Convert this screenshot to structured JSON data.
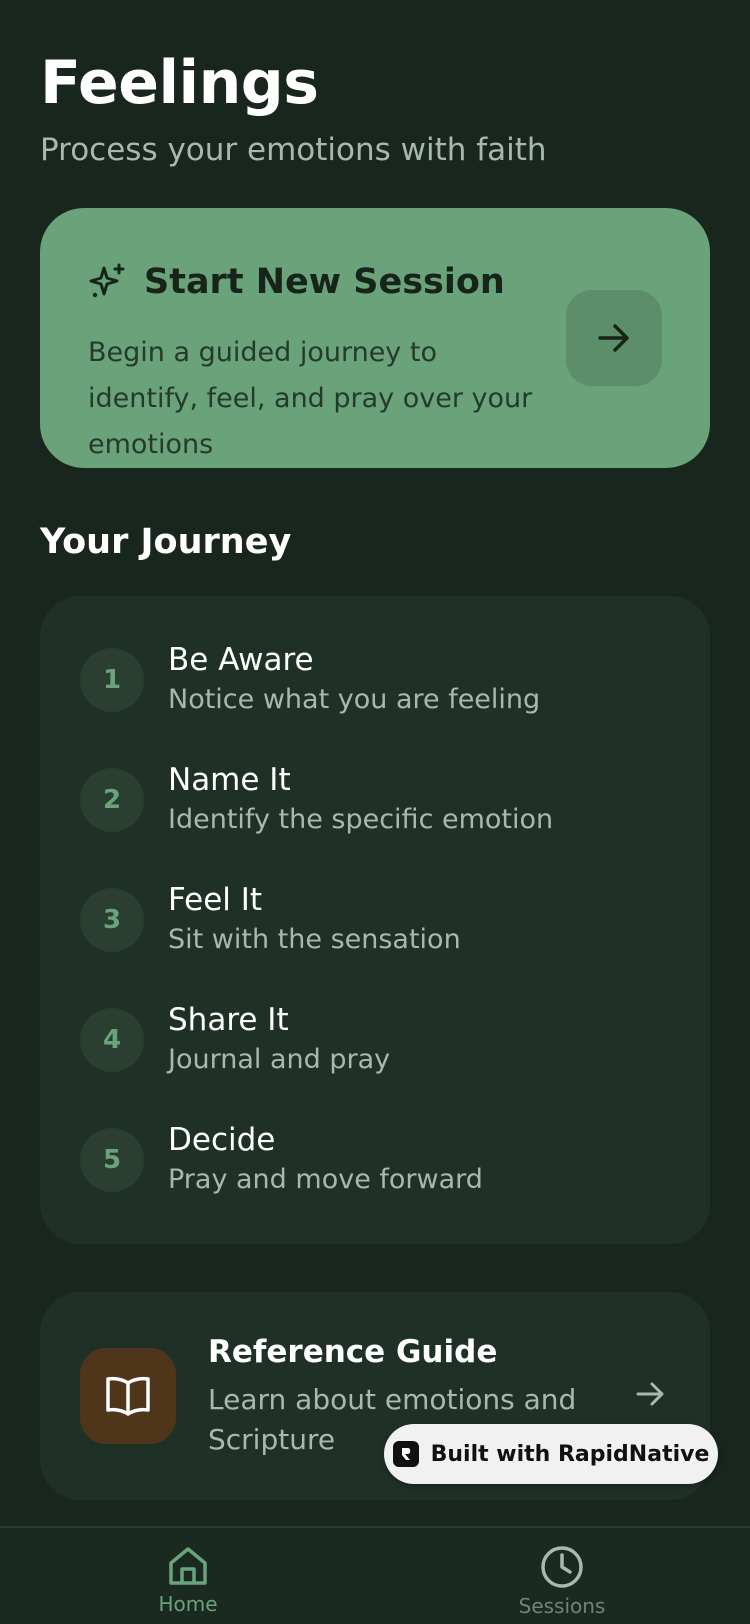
{
  "header": {
    "title": "Feelings",
    "subtitle": "Process your emotions with faith"
  },
  "session_card": {
    "title": "Start New Session",
    "description": "Begin a guided journey to identify, feel, and pray over your emotions",
    "icon": "sparkle-icon",
    "action_icon": "arrow-right-icon"
  },
  "journey": {
    "title": "Your Journey",
    "steps": [
      {
        "number": "1",
        "title": "Be Aware",
        "description": "Notice what you are feeling"
      },
      {
        "number": "2",
        "title": "Name It",
        "description": "Identify the specific emotion"
      },
      {
        "number": "3",
        "title": "Feel It",
        "description": "Sit with the sensation"
      },
      {
        "number": "4",
        "title": "Share It",
        "description": "Journal and pray"
      },
      {
        "number": "5",
        "title": "Decide",
        "description": "Pray and move forward"
      }
    ]
  },
  "reference": {
    "title": "Reference Guide",
    "description": "Learn about emotions and Scripture",
    "icon": "book-icon"
  },
  "badge": {
    "text": "Built with RapidNative"
  },
  "nav": {
    "items": [
      {
        "label": "Home",
        "icon": "home-icon",
        "active": true
      },
      {
        "label": "Sessions",
        "icon": "clock-icon",
        "active": false
      }
    ]
  },
  "colors": {
    "background": "#18261d",
    "accent": "#6aa27a",
    "card": "#1f3126",
    "book_tile": "#4f3519"
  }
}
